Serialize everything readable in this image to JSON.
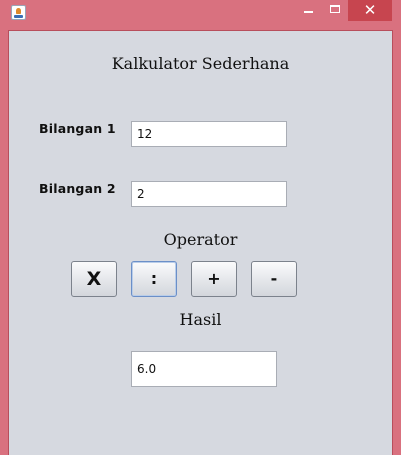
{
  "window": {
    "controls": {
      "minimize": "minimize",
      "maximize": "maximize",
      "close_label": "✕"
    },
    "colors": {
      "frame": "#d9717f",
      "client": "#d6d9e0",
      "close": "#c7454f"
    }
  },
  "form": {
    "title": "Kalkulator Sederhana",
    "bilangan1_label": "Bilangan 1",
    "bilangan1_value": "12",
    "bilangan2_label": "Bilangan 2",
    "bilangan2_value": "2",
    "operator_label": "Operator",
    "operators": {
      "multiply": "X",
      "divide": ":",
      "add": "+",
      "subtract": "-"
    },
    "hasil_label": "Hasil",
    "hasil_value": "6.0"
  },
  "icons": {
    "app": "java-app-icon",
    "minimize": "minimize-icon",
    "maximize": "maximize-icon",
    "close": "close-icon"
  }
}
